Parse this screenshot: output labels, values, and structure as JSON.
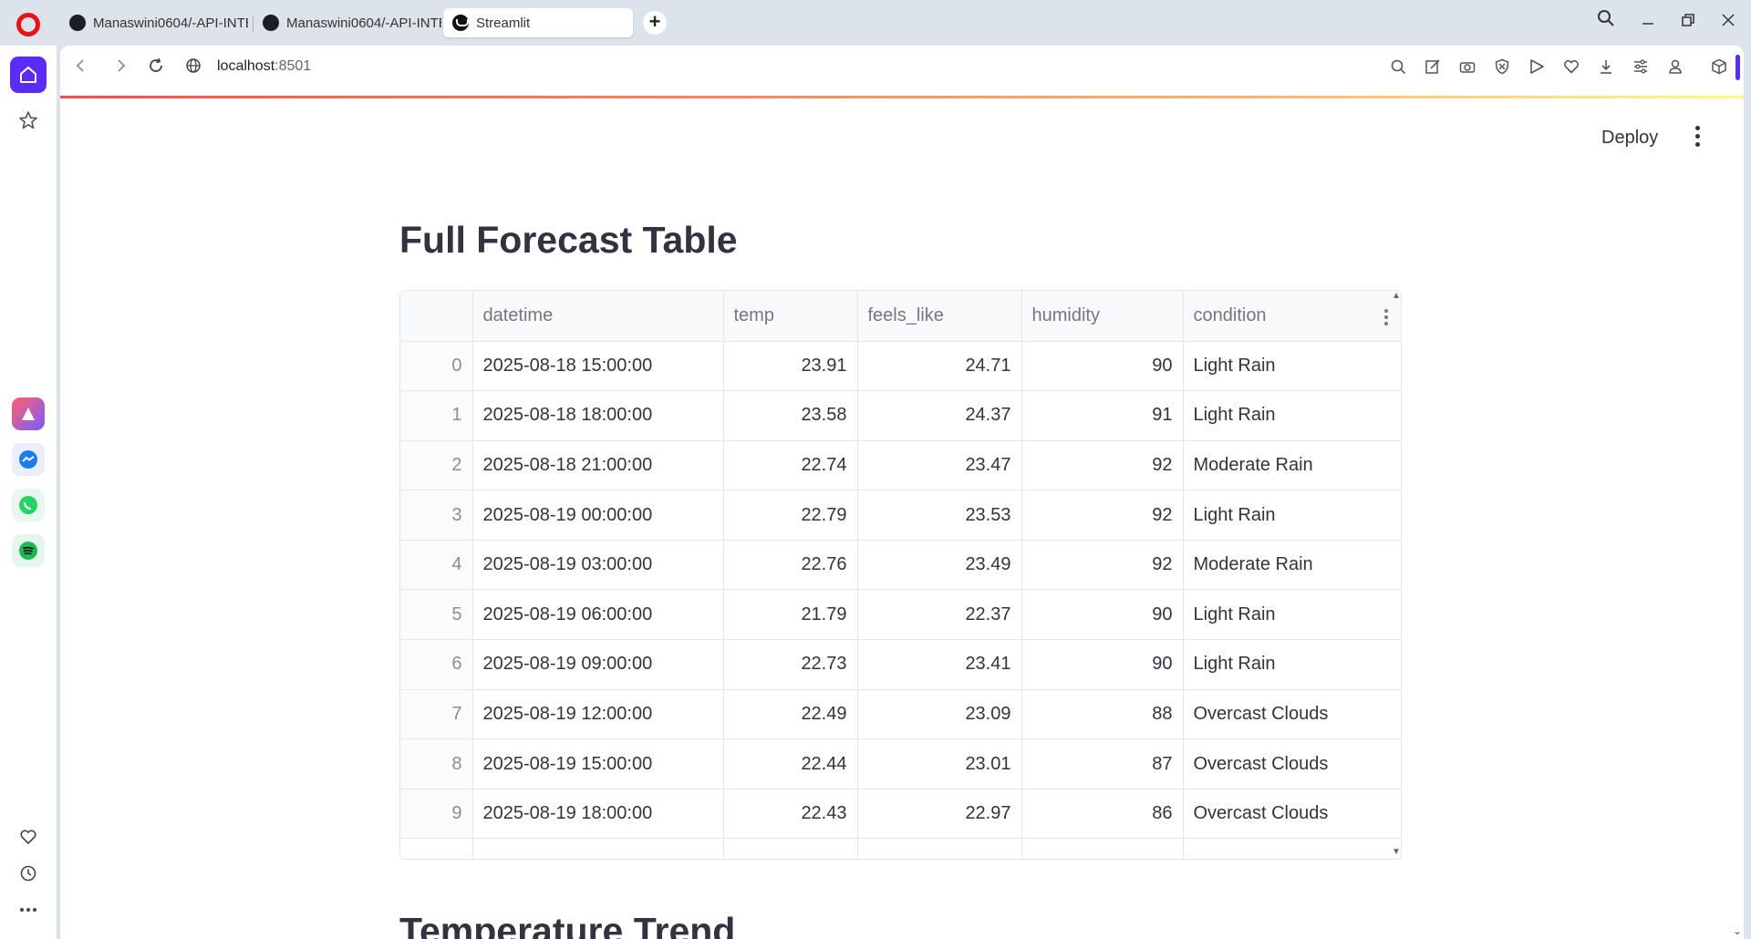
{
  "browser": {
    "tabs": [
      {
        "title": "Manaswini0604/-API-INTE",
        "active": false
      },
      {
        "title": "Manaswini0604/-API-INTE",
        "active": false
      },
      {
        "title": "Streamlit",
        "active": true
      }
    ],
    "url_host": "localhost",
    "url_port": ":8501",
    "accent_color": "#5a2cf5",
    "sidebar_apps": [
      "aria-icon",
      "messenger-icon",
      "whatsapp-icon",
      "spotify-icon"
    ]
  },
  "app": {
    "deploy_label": "Deploy",
    "table_title": "Full Forecast Table",
    "next_title": "Temperature Trend",
    "columns": [
      "",
      "datetime",
      "temp",
      "feels_like",
      "humidity",
      "condition"
    ],
    "rows": [
      {
        "idx": "0",
        "datetime": "2025-08-18 15:00:00",
        "temp": "23.91",
        "feels_like": "24.71",
        "humidity": "90",
        "condition": "Light Rain"
      },
      {
        "idx": "1",
        "datetime": "2025-08-18 18:00:00",
        "temp": "23.58",
        "feels_like": "24.37",
        "humidity": "91",
        "condition": "Light Rain"
      },
      {
        "idx": "2",
        "datetime": "2025-08-18 21:00:00",
        "temp": "22.74",
        "feels_like": "23.47",
        "humidity": "92",
        "condition": "Moderate Rain"
      },
      {
        "idx": "3",
        "datetime": "2025-08-19 00:00:00",
        "temp": "22.79",
        "feels_like": "23.53",
        "humidity": "92",
        "condition": "Light Rain"
      },
      {
        "idx": "4",
        "datetime": "2025-08-19 03:00:00",
        "temp": "22.76",
        "feels_like": "23.49",
        "humidity": "92",
        "condition": "Moderate Rain"
      },
      {
        "idx": "5",
        "datetime": "2025-08-19 06:00:00",
        "temp": "21.79",
        "feels_like": "22.37",
        "humidity": "90",
        "condition": "Light Rain"
      },
      {
        "idx": "6",
        "datetime": "2025-08-19 09:00:00",
        "temp": "22.73",
        "feels_like": "23.41",
        "humidity": "90",
        "condition": "Light Rain"
      },
      {
        "idx": "7",
        "datetime": "2025-08-19 12:00:00",
        "temp": "22.49",
        "feels_like": "23.09",
        "humidity": "88",
        "condition": "Overcast Clouds"
      },
      {
        "idx": "8",
        "datetime": "2025-08-19 15:00:00",
        "temp": "22.44",
        "feels_like": "23.01",
        "humidity": "87",
        "condition": "Overcast Clouds"
      },
      {
        "idx": "9",
        "datetime": "2025-08-19 18:00:00",
        "temp": "22.43",
        "feels_like": "22.97",
        "humidity": "86",
        "condition": "Overcast Clouds"
      }
    ]
  }
}
